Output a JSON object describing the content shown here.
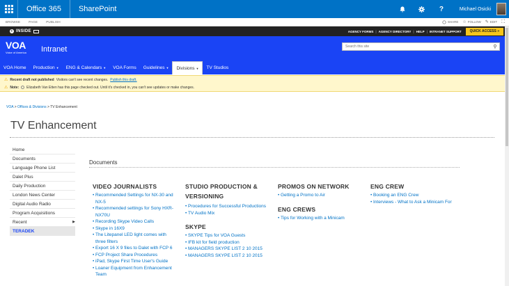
{
  "suitebar": {
    "app_name": "Office 365",
    "product": "SharePoint",
    "user_name": "Michael Osicki"
  },
  "ribbon": {
    "tabs": [
      "BROWSE",
      "PAGE",
      "PUBLISH"
    ],
    "actions": {
      "share": "SHARE",
      "follow": "FOLLOW",
      "edit": "EDIT"
    }
  },
  "blackbar": {
    "brand": "INSIDE",
    "links": [
      "AGENCY FORMS",
      "AGENCY DIRECTORY",
      "HELP",
      "INTRANET SUPPORT"
    ],
    "quick_access": "QUICK ACCESS »"
  },
  "header": {
    "logo_mark": "VOA",
    "logo_sub": "Voice of America",
    "site_title": "Intranet",
    "search_placeholder": "Search this site"
  },
  "nav": {
    "items": [
      {
        "label": "VOA Home",
        "caret": false
      },
      {
        "label": "Production",
        "caret": true
      },
      {
        "label": "ENG & Calendars",
        "caret": true
      },
      {
        "label": "VOA Forms",
        "caret": false
      },
      {
        "label": "Guidelines",
        "caret": true
      },
      {
        "label": "Divisions",
        "caret": true,
        "active": true
      },
      {
        "label": "TV Studios",
        "caret": false
      }
    ]
  },
  "status": {
    "line1_label": "Recent draft not published",
    "line1_text": "Visitors can't see recent changes.",
    "line1_link": "Publish this draft.",
    "line2_label": "Note:",
    "line2_text": "Elizabeth Van Etten has this page checked out. Until it's checked in, you can't see updates or make changes."
  },
  "breadcrumb": {
    "items": [
      "VOA",
      "Offices & Divisions"
    ],
    "current": "TV Enhancement",
    "separator": ">"
  },
  "page_title": "TV Enhancement",
  "leftnav": {
    "items": [
      {
        "label": "Home"
      },
      {
        "label": "Documents"
      },
      {
        "label": "Language Phone List"
      },
      {
        "label": "Dalet Plus"
      },
      {
        "label": "Daily Production"
      },
      {
        "label": "London News Center"
      },
      {
        "label": "Digital Audio Radio"
      },
      {
        "label": "Program Acquisitions"
      },
      {
        "label": "Recent",
        "arrow": true
      },
      {
        "label": "TERADEK",
        "selected": true
      }
    ]
  },
  "documents_heading": "Documents",
  "columns": {
    "video_journalists": {
      "title": "VIDEO JOURNALISTS",
      "links": [
        "Recommended Settings for NX-30 and NX-5",
        "Recommended settings for Sony HXR-NX70U",
        "Recording Skype Video Calls",
        "Skype in 16X9",
        "The Litepanel LED light comes with three filters",
        "Export 16 X 9 files to Dalet with FCP 6",
        "FCP Project Share Procedures",
        "iPad, Skype First Time User's Guide",
        "Loaner Equipment from Enhancement Team"
      ]
    },
    "studio_production": {
      "title": "STUDIO PRODUCTION & VERSIONING",
      "links": [
        "Procedures for Successful Productions",
        "TV Audio Mix"
      ]
    },
    "skype": {
      "title": "SKYPE",
      "links": [
        "SKYPE Tips for VOA Guests",
        "IFB kit for field production",
        "MANAGERS SKYPE LIST 2 10 2015",
        "MANAGERS SKYPE LIST 2 10 2015"
      ]
    },
    "promos": {
      "title": "PROMOS ON NETWORK",
      "links": [
        "Getting a Promo to Air"
      ]
    },
    "eng_crews": {
      "title": "ENG CREWS",
      "links": [
        "Tips for Working with a Minicam"
      ]
    },
    "eng_crew": {
      "title": "ENG CREW",
      "links": [
        "Booking an ENG Crew",
        "Interviews - What to Ask a Minicam For"
      ]
    }
  },
  "colors": {
    "suite_blue": "#0072c6",
    "voa_blue": "#1a44f5",
    "quick_access": "#f7c51b",
    "status_bg": "#fff7cc",
    "link": "#0072c6"
  },
  "icons": [
    "app-launcher-icon",
    "bell-icon",
    "gear-icon",
    "help-icon",
    "share-icon",
    "follow-star-icon",
    "edit-pencil-icon",
    "focus-mode-icon",
    "search-icon",
    "warning-icon"
  ]
}
